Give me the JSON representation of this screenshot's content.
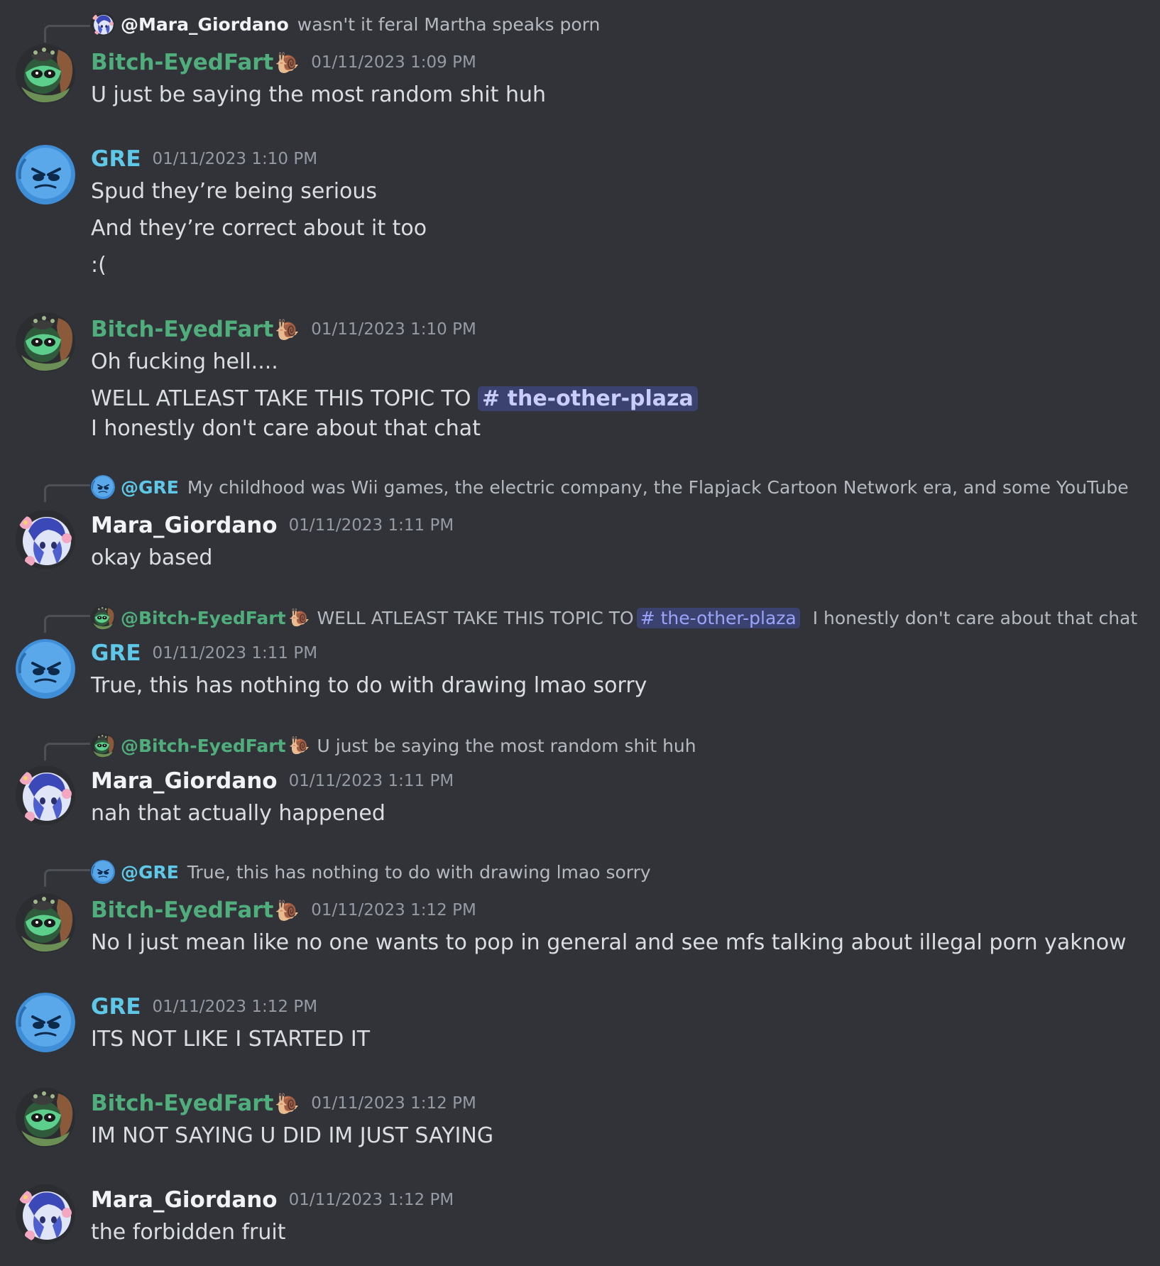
{
  "icons": {
    "snail": "🐌",
    "hash": "#"
  },
  "colors": {
    "bg": "#313338",
    "green_user": "#4fae7c",
    "blue_user": "#5fc8e8",
    "channel_chip": "#3c4270"
  },
  "messages": [
    {
      "reply": {
        "name": "@Mara_Giordano",
        "text": "wasn't it feral Martha speaks porn"
      },
      "author": "Bitch-EyedFart",
      "timestamp": "01/11/2023 1:09 PM",
      "lines": [
        "U just be saying the most random shit huh"
      ]
    },
    {
      "author": "GRE",
      "timestamp": "01/11/2023 1:10 PM",
      "lines": [
        "Spud they’re being serious",
        "And they’re correct about it too",
        ":("
      ]
    },
    {
      "author": "Bitch-EyedFart",
      "timestamp": "01/11/2023 1:10 PM",
      "lines": [
        "Oh fucking hell....",
        "WELL ATLEAST TAKE THIS TOPIC TO",
        " I honestly don't care about that chat"
      ],
      "channel": "# the-other-plaza"
    },
    {
      "reply": {
        "name": "@GRE",
        "text": "My childhood was Wii games, the electric company, the Flapjack Cartoon Network era, and some YouTube"
      },
      "author": "Mara_Giordano",
      "timestamp": "01/11/2023 1:11 PM",
      "lines": [
        "okay based"
      ]
    },
    {
      "reply": {
        "name": "@Bitch-EyedFart",
        "text": "WELL ATLEAST TAKE THIS TOPIC TO",
        "channel": "# the-other-plaza",
        "text_after": "I honestly don't care about that chat"
      },
      "author": "GRE",
      "timestamp": "01/11/2023 1:11 PM",
      "lines": [
        "True, this has nothing to do with drawing lmao sorry"
      ]
    },
    {
      "reply": {
        "name": "@Bitch-EyedFart",
        "text": "U just be saying the most random shit huh"
      },
      "author": "Mara_Giordano",
      "timestamp": "01/11/2023 1:11 PM",
      "lines": [
        "nah that actually happened"
      ]
    },
    {
      "reply": {
        "name": "@GRE",
        "text": "True, this has nothing to do with drawing lmao sorry"
      },
      "author": "Bitch-EyedFart",
      "timestamp": "01/11/2023 1:12 PM",
      "lines": [
        "No I just mean like no one wants to pop in general and see mfs talking about illegal porn yaknow"
      ]
    },
    {
      "author": "GRE",
      "timestamp": "01/11/2023 1:12 PM",
      "lines": [
        "ITS NOT LIKE I STARTED IT"
      ]
    },
    {
      "author": "Bitch-EyedFart",
      "timestamp": "01/11/2023 1:12 PM",
      "lines": [
        "IM NOT SAYING U DID IM JUST SAYING"
      ]
    },
    {
      "author": "Mara_Giordano",
      "timestamp": "01/11/2023 1:12 PM",
      "lines": [
        "the forbidden fruit"
      ]
    }
  ]
}
